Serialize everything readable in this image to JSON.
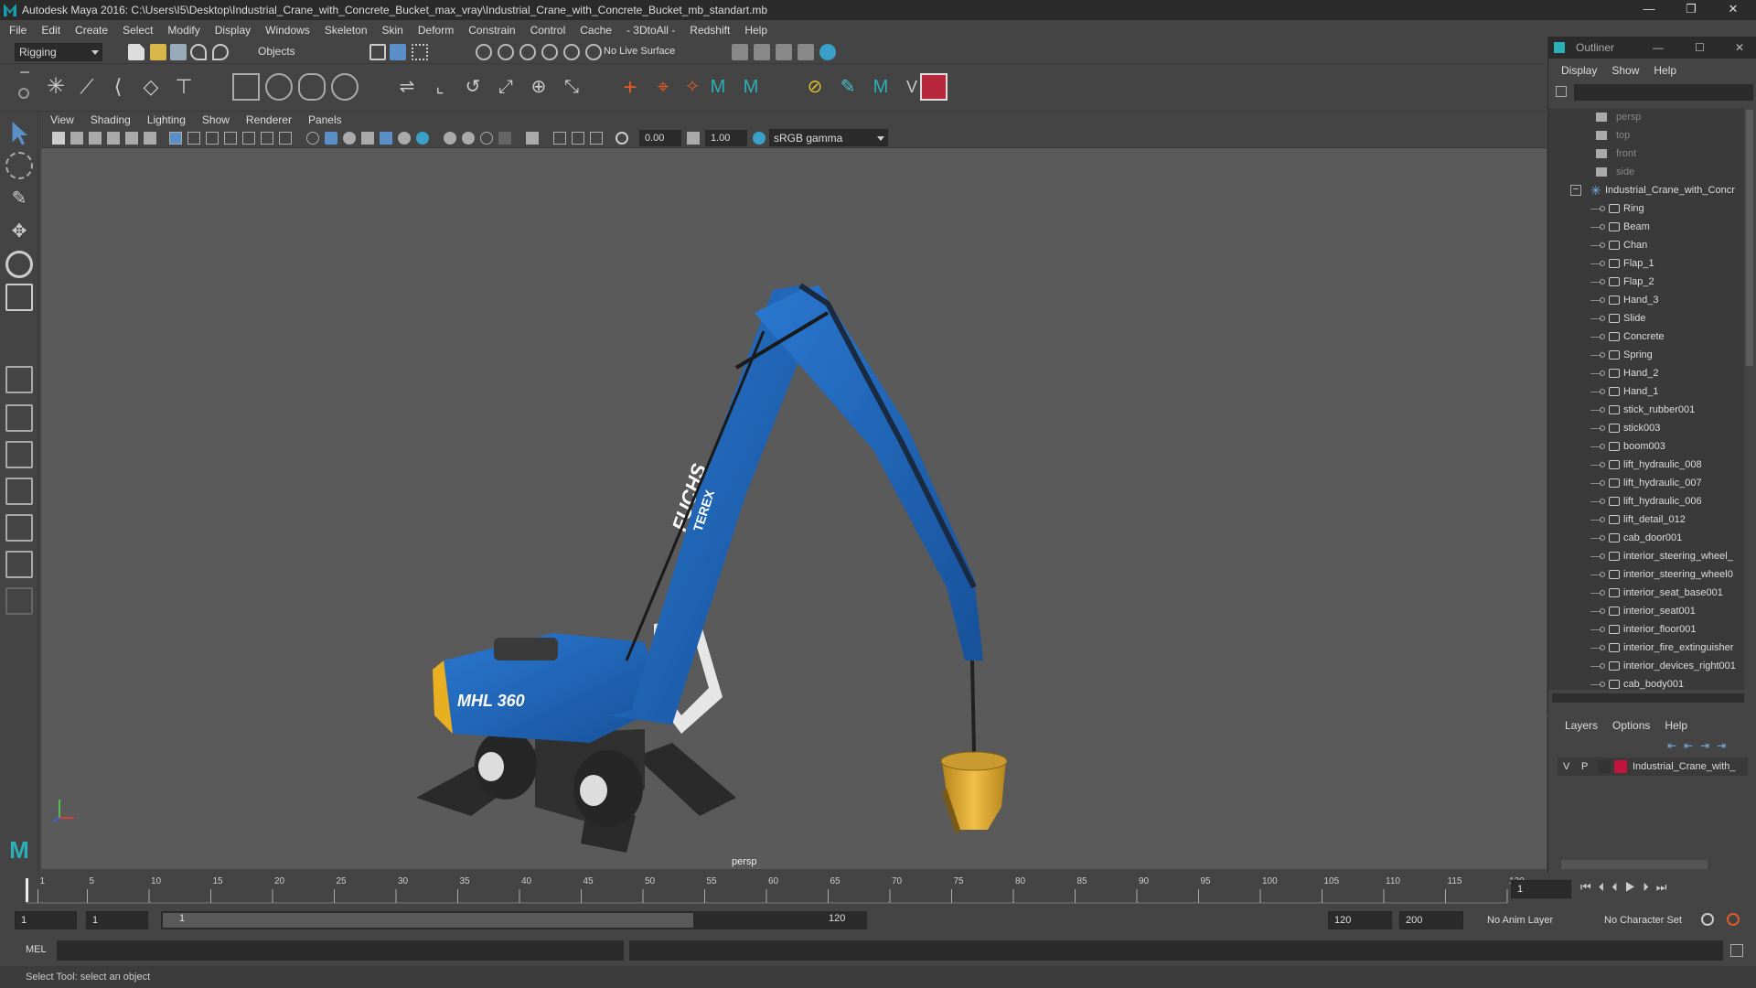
{
  "window": {
    "title": "Autodesk Maya 2016: C:\\Users\\I5\\Desktop\\Industrial_Crane_with_Concrete_Bucket_max_vray\\Industrial_Crane_with_Concrete_Bucket_mb_standart.mb",
    "controls": [
      "—",
      "❐",
      "✕"
    ]
  },
  "menubar": [
    "File",
    "Edit",
    "Create",
    "Select",
    "Modify",
    "Display",
    "Windows",
    "Skeleton",
    "Skin",
    "Deform",
    "Constrain",
    "Control",
    "Cache",
    "- 3DtoAll -",
    "Redshift",
    "Help"
  ],
  "statusline": {
    "menuset": "Rigging",
    "selection_mode": "Objects",
    "live_surface": "No Live Surface"
  },
  "viewport": {
    "menus": [
      "View",
      "Shading",
      "Lighting",
      "Show",
      "Renderer",
      "Panels"
    ],
    "exposure": "0.00",
    "gamma": "1.00",
    "color_space": "sRGB gamma",
    "camera": "persp"
  },
  "scene": {
    "machine_text": "MHL 360",
    "boom_text_1": "FUCHS",
    "boom_text_2": "TEREX",
    "crane_color": "#1f64b8",
    "bucket_color": "#d9a22e",
    "background": "#5a5a5a"
  },
  "timeline": {
    "ticks": [
      "1",
      "5",
      "10",
      "15",
      "20",
      "25",
      "30",
      "35",
      "40",
      "45",
      "50",
      "55",
      "60",
      "65",
      "70",
      "75",
      "80",
      "85",
      "90",
      "95",
      "100",
      "105",
      "110",
      "115",
      "120"
    ],
    "current_frame": "1"
  },
  "range": {
    "start": "1",
    "playback_start": "1",
    "slider_start": "1",
    "slider_end": "120",
    "playback_end": "120",
    "end": "200",
    "anim_layer": "No Anim Layer",
    "character_set": "No Character Set"
  },
  "commandline": {
    "label": "MEL"
  },
  "helpline": {
    "text": "Select Tool: select an object"
  },
  "outliner": {
    "title": "Outliner",
    "menus": [
      "Display",
      "Show",
      "Help"
    ],
    "cameras": [
      "persp",
      "top",
      "front",
      "side"
    ],
    "root": "Industrial_Crane_with_Concr",
    "children": [
      "Ring",
      "Beam",
      "Chan",
      "Flap_1",
      "Flap_2",
      "Hand_3",
      "Slide",
      "Concrete",
      "Spring",
      "Hand_2",
      "Hand_1",
      "stick_rubber001",
      "stick003",
      "boom003",
      "lift_hydraulic_008",
      "lift_hydraulic_007",
      "lift_hydraulic_006",
      "lift_detail_012",
      "cab_door001",
      "interior_steering_wheel_",
      "interior_steering_wheel0",
      "interior_seat_base001",
      "interior_seat001",
      "interior_floor001",
      "interior_fire_extinguisher",
      "interior_devices_right001",
      "cab_body001"
    ]
  },
  "layers": {
    "menus": [
      "Layers",
      "Options",
      "Help"
    ],
    "row": {
      "v": "V",
      "p": "P",
      "name": "Industrial_Crane_with_",
      "color": "#c0143c"
    }
  }
}
